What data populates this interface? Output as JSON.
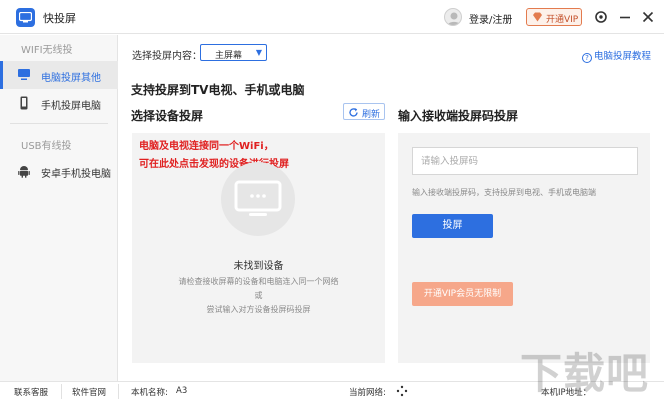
{
  "app": {
    "name": "快投屏",
    "brand_color": "#2d6fe0"
  },
  "header": {
    "login_label": "登录/注册",
    "vip_label": "开通VIP"
  },
  "sidebar": {
    "wifi_section": "WIFI无线投",
    "usb_section": "USB有线投",
    "items": [
      {
        "label": "电脑投屏其他",
        "icon": "monitor-icon",
        "active": true
      },
      {
        "label": "手机投屏电脑",
        "icon": "phone-icon",
        "active": false
      },
      {
        "label": "安卓手机投电脑",
        "icon": "android-icon",
        "active": false
      }
    ]
  },
  "main": {
    "mode_label": "选择投屏内容：",
    "mode_value": "主屏幕",
    "help_link": "电脑投屏教程",
    "headline": "支持投屏到TV电视、手机或电脑",
    "left": {
      "title": "选择设备投屏",
      "refresh_label": "刷新",
      "hint_line1": "电脑及电视连接同一个WiFi，",
      "hint_line2": "可在此处点击发现的设备进行投屏",
      "empty_title": "未找到设备",
      "empty_desc_line1": "请检查接收屏幕的设备和电脑连入同一个网络",
      "empty_desc_line2": "或",
      "empty_desc_line3": "尝试输入对方设备投屏码投屏"
    },
    "right": {
      "title": "输入接收端投屏码投屏",
      "code_placeholder": "请输入投屏码",
      "code_hint": "输入接收端投屏码，支持投屏到电视、手机或电脑端",
      "cast_button": "投屏",
      "vip_button": "开通VIP会员无限制"
    }
  },
  "statusbar": {
    "contact": "联系客服",
    "website": "软件官网",
    "machine_label": "本机名称:",
    "machine_value": "A3",
    "network_label": "当前网络:",
    "ip_label": "本机IP地址："
  },
  "watermark": "下载吧"
}
